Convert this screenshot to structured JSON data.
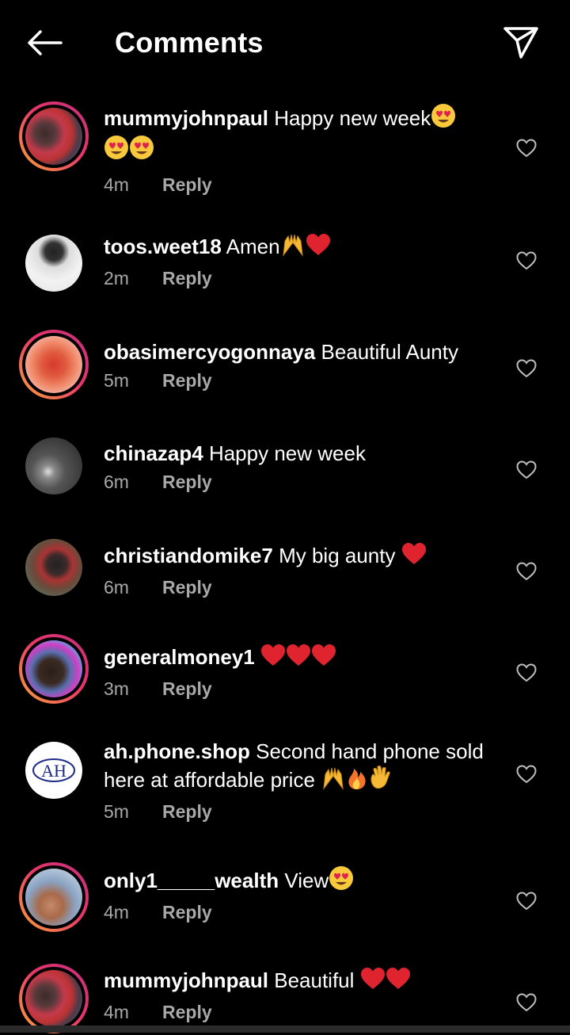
{
  "header": {
    "title": "Comments"
  },
  "comments": [
    {
      "username": "mummyjohnpaul",
      "text": " Happy new week",
      "emojis": [
        "heart-eyes",
        "heart-eyes",
        "heart-eyes"
      ],
      "time": "4m",
      "reply": "Reply"
    },
    {
      "username": "toos.weet18",
      "text": " Amen",
      "emojis": [
        "raised-hands",
        "red-heart"
      ],
      "time": "2m",
      "reply": "Reply"
    },
    {
      "username": "obasimercyogonnaya",
      "text": " Beautiful Aunty",
      "emojis": [],
      "time": "5m",
      "reply": "Reply"
    },
    {
      "username": "chinazap4",
      "text": " Happy new week",
      "emojis": [],
      "time": "6m",
      "reply": "Reply"
    },
    {
      "username": "christiandomike7",
      "text": " My big aunty ",
      "emojis": [
        "red-heart"
      ],
      "time": "6m",
      "reply": "Reply"
    },
    {
      "username": "generalmoney1",
      "text": " ",
      "emojis": [
        "red-heart",
        "red-heart",
        "red-heart"
      ],
      "time": "3m",
      "reply": "Reply"
    },
    {
      "username": "ah.phone.shop",
      "text": " Second hand phone sold here at affordable price ",
      "emojis": [
        "raised-hands",
        "fire",
        "waving-hand"
      ],
      "time": "5m",
      "reply": "Reply"
    },
    {
      "username": "only1_____wealth",
      "text": " View",
      "emojis": [
        "heart-eyes"
      ],
      "time": "4m",
      "reply": "Reply"
    },
    {
      "username": "mummyjohnpaul",
      "text": " Beautiful ",
      "emojis": [
        "red-heart",
        "red-heart"
      ],
      "time": "4m",
      "reply": "Reply"
    }
  ],
  "avatar_logo_text": "AH",
  "colors": {
    "background": "#000000",
    "secondary_text": "#a8a8a8",
    "story_ring_start": "#f9a638",
    "story_ring_end": "#c2307f"
  }
}
